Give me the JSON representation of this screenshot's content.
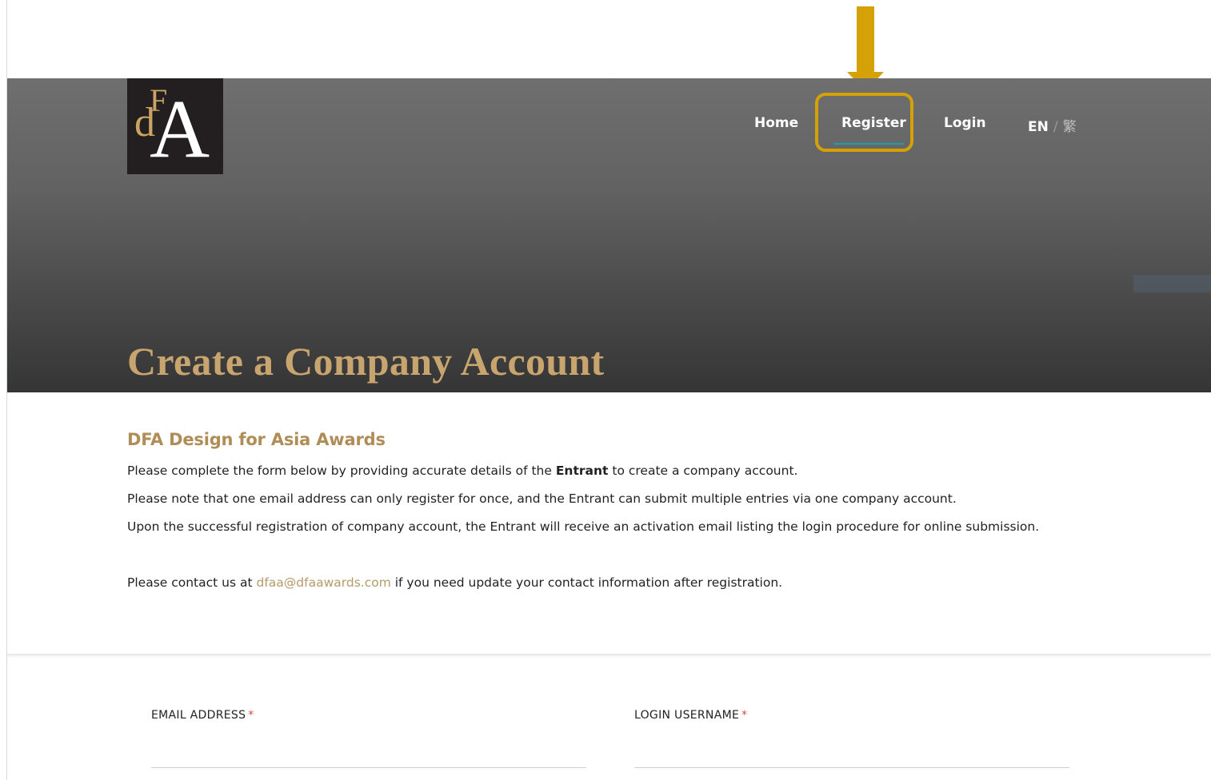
{
  "nav": {
    "home": "Home",
    "register": "Register",
    "login": "Login",
    "lang_en": "EN",
    "lang_sep": "/",
    "lang_zh": "繁"
  },
  "logo": {
    "d": "d",
    "f": "F",
    "a": "A"
  },
  "hero": {
    "title": "Create a Company Account"
  },
  "intro": {
    "heading": "DFA Design for Asia Awards",
    "line1_before": "Please complete the form below by providing accurate details of the ",
    "line1_bold": "Entrant",
    "line1_after": " to create a company account.",
    "line2": "Please note that one email address can only register for once, and the Entrant can submit multiple entries via one company account.",
    "line3": "Upon the successful registration of company account, the Entrant will receive an activation email listing the login procedure for online submission.",
    "contact_before": "Please contact us at ",
    "contact_email": "dfaa@dfaawards.com",
    "contact_after": " if you need update your contact information after registration."
  },
  "form": {
    "email_label": "EMAIL ADDRESS",
    "username_label": "LOGIN USERNAME",
    "required_mark": "*",
    "email_value": "",
    "username_value": ""
  },
  "colors": {
    "accent_gold": "#c8a46e",
    "annotation": "#d4a106",
    "nav_active_underline": "#1c9bb3"
  }
}
